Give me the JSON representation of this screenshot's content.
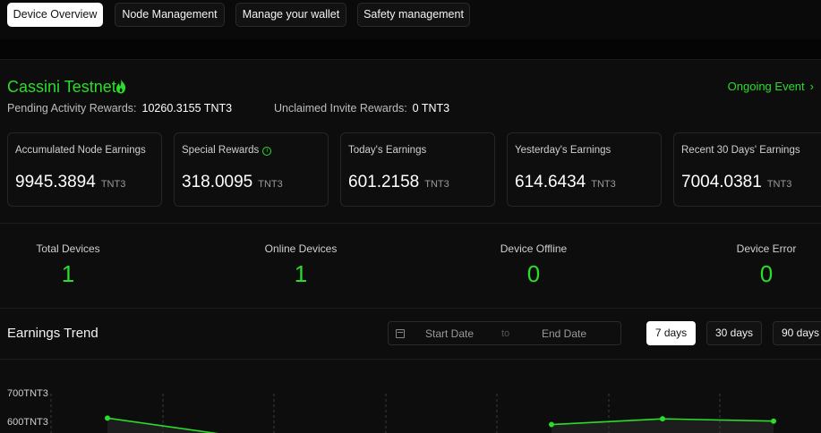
{
  "tabs": [
    {
      "label": "Device Overview",
      "active": true
    },
    {
      "label": "Node Management",
      "active": false
    },
    {
      "label": "Manage your wallet",
      "active": false
    },
    {
      "label": "Safety management",
      "active": false
    }
  ],
  "network": {
    "title": "Cassini Testnet",
    "icon": "flame-icon",
    "event_label": "Ongoing Event",
    "pending_label": "Pending Activity Rewards:",
    "pending_value": "10260.3155 TNT3",
    "unclaimed_label": "Unclaimed Invite Rewards:",
    "unclaimed_value": "0 TNT3"
  },
  "cards": [
    {
      "label": "Accumulated Node Earnings",
      "value": "9945.3894",
      "unit": "TNT3",
      "info": false
    },
    {
      "label": "Special Rewards",
      "value": "318.0095",
      "unit": "TNT3",
      "info": true
    },
    {
      "label": "Today's Earnings",
      "value": "601.2158",
      "unit": "TNT3",
      "info": false
    },
    {
      "label": "Yesterday's Earnings",
      "value": "614.6434",
      "unit": "TNT3",
      "info": false
    },
    {
      "label": "Recent 30 Days' Earnings",
      "value": "7004.0381",
      "unit": "TNT3",
      "info": false
    }
  ],
  "stats": [
    {
      "label": "Total Devices",
      "value": "1"
    },
    {
      "label": "Online Devices",
      "value": "1"
    },
    {
      "label": "Device Offline",
      "value": "0"
    },
    {
      "label": "Device Error",
      "value": "0"
    }
  ],
  "trend": {
    "title": "Earnings Trend",
    "start_placeholder": "Start Date",
    "separator": "to",
    "end_placeholder": "End Date",
    "ranges": [
      {
        "label": "7 days",
        "active": true
      },
      {
        "label": "30 days",
        "active": false
      },
      {
        "label": "90 days",
        "active": false
      }
    ]
  },
  "colors": {
    "accent": "#2bdc2b",
    "background": "#0a0a0a"
  },
  "chart_data": {
    "type": "line",
    "ytick_labels": [
      "700TNT3",
      "600TNT3"
    ],
    "series": [
      {
        "values": [
          614.6,
          560,
          null,
          null,
          592,
          612,
          604
        ]
      }
    ]
  }
}
